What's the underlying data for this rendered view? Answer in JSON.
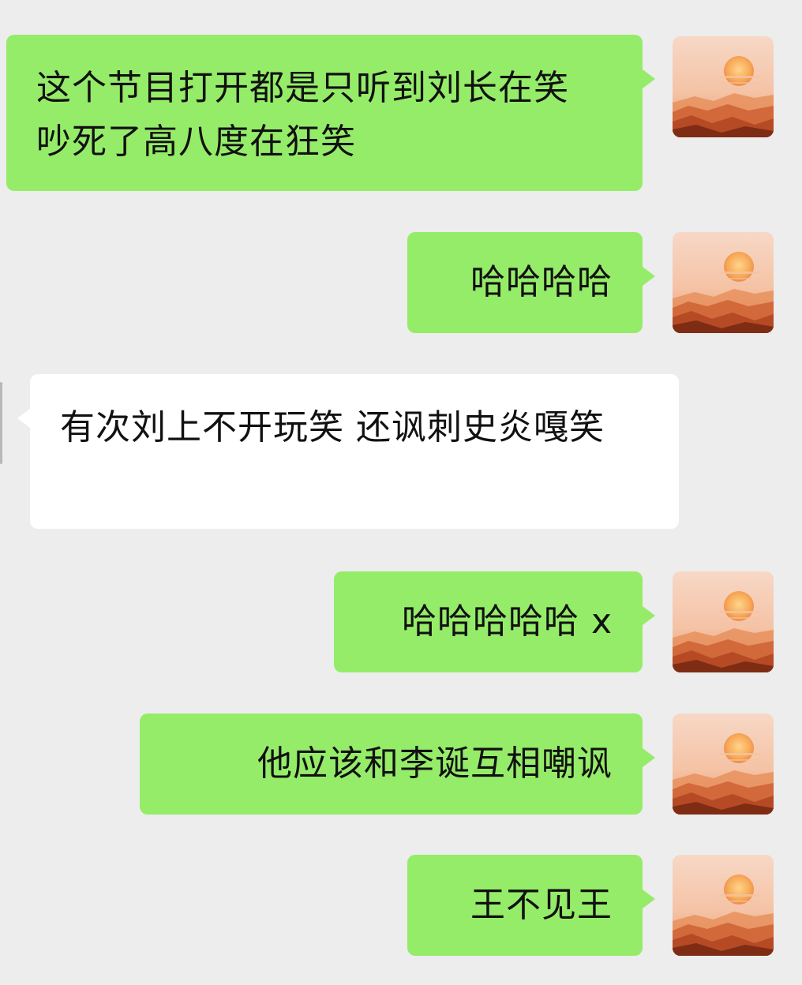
{
  "messages": [
    {
      "side": "sent",
      "text": "这个节目打开都是只听到刘长在笑 吵死了高八度在狂笑"
    },
    {
      "side": "sent",
      "text": "哈哈哈哈"
    },
    {
      "side": "received",
      "text": "有次刘上不开玩笑 还讽刺史炎嘎笑"
    },
    {
      "side": "sent",
      "text": "哈哈哈哈哈 x"
    },
    {
      "side": "sent",
      "text": "他应该和李诞互相嘲讽"
    },
    {
      "side": "sent",
      "text": "王不见王"
    }
  ],
  "colors": {
    "background": "#ededed",
    "sent_bubble": "#95ec69",
    "received_bubble": "#ffffff"
  },
  "avatar": {
    "icon": "sunset-mountain-avatar-icon"
  }
}
